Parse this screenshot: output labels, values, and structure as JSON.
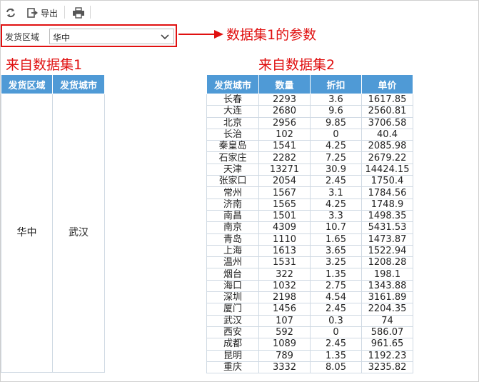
{
  "toolbar": {
    "refresh_icon": "refresh-icon",
    "export_label": "导出",
    "export_icon": "export-icon",
    "print_icon": "print-icon"
  },
  "param": {
    "label": "发货区域",
    "value": "华中"
  },
  "annotation": "数据集1的参数",
  "dataset1": {
    "title": "来自数据集1",
    "headers": [
      "发货区域",
      "发货城市"
    ],
    "rows": [
      [
        "华中",
        "武汉"
      ]
    ]
  },
  "dataset2": {
    "title": "来自数据集2",
    "headers": [
      "发货城市",
      "数量",
      "折扣",
      "单价"
    ],
    "rows": [
      [
        "长春",
        "2293",
        "3.6",
        "1617.85"
      ],
      [
        "大连",
        "2680",
        "9.6",
        "2560.81"
      ],
      [
        "北京",
        "2956",
        "9.85",
        "3706.58"
      ],
      [
        "长治",
        "102",
        "0",
        "40.4"
      ],
      [
        "秦皇岛",
        "1541",
        "4.25",
        "2085.98"
      ],
      [
        "石家庄",
        "2282",
        "7.25",
        "2679.22"
      ],
      [
        "天津",
        "13271",
        "30.9",
        "14424.15"
      ],
      [
        "张家口",
        "2054",
        "2.45",
        "1750.4"
      ],
      [
        "常州",
        "1567",
        "3.1",
        "1784.56"
      ],
      [
        "济南",
        "1565",
        "4.25",
        "1748.9"
      ],
      [
        "南昌",
        "1501",
        "3.3",
        "1498.35"
      ],
      [
        "南京",
        "4309",
        "10.7",
        "5431.53"
      ],
      [
        "青岛",
        "1110",
        "1.65",
        "1473.87"
      ],
      [
        "上海",
        "1613",
        "3.65",
        "1522.94"
      ],
      [
        "温州",
        "1531",
        "3.25",
        "1208.28"
      ],
      [
        "烟台",
        "322",
        "1.35",
        "198.1"
      ],
      [
        "海口",
        "1032",
        "2.75",
        "1343.88"
      ],
      [
        "深圳",
        "2198",
        "4.54",
        "3161.89"
      ],
      [
        "厦门",
        "1456",
        "2.45",
        "2204.35"
      ],
      [
        "武汉",
        "107",
        "0.3",
        "74"
      ],
      [
        "西安",
        "592",
        "0",
        "586.07"
      ],
      [
        "成都",
        "1089",
        "2.45",
        "961.65"
      ],
      [
        "昆明",
        "789",
        "1.35",
        "1192.23"
      ],
      [
        "重庆",
        "3332",
        "8.05",
        "3235.82"
      ]
    ]
  },
  "colors": {
    "header_bg": "#4f9ad6",
    "annotation": "#e01010",
    "grid": "#cfd9e3"
  }
}
